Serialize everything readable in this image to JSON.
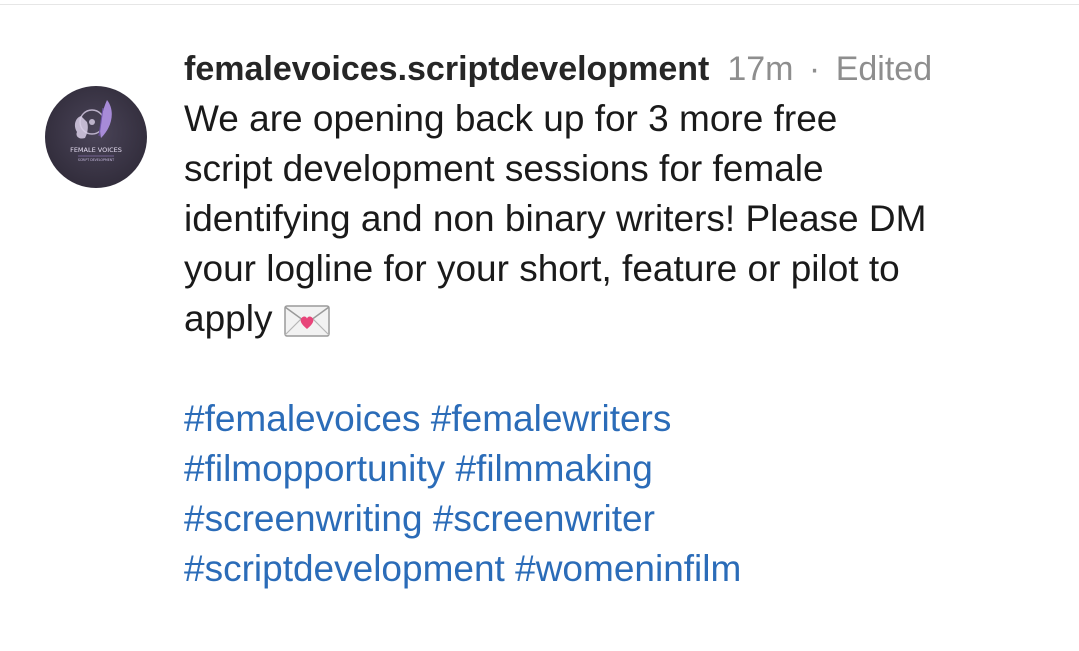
{
  "post": {
    "username": "femalevoices.scriptdevelopment",
    "timestamp": "17m",
    "separator": "·",
    "edited_label": "Edited",
    "avatar_text": "FEMALE VOICES",
    "avatar_subtext": "SCRIPT DEVELOPMENT",
    "caption_lines": [
      "We are opening back up for 3 more free",
      "script development sessions for female",
      "identifying and non binary writers! Please DM",
      "your logline for your short, feature or pilot to",
      "apply"
    ],
    "hashtag_lines": [
      [
        "#femalevoices",
        "#femalewriters"
      ],
      [
        "#filmopportunity",
        "#filmmaking"
      ],
      [
        "#screenwriting",
        "#screenwriter"
      ],
      [
        "#scriptdevelopment",
        "#womeninfilm"
      ]
    ],
    "emoji_icon": "love-letter-icon",
    "colors": {
      "username": "#262626",
      "meta": "#8e8e8e",
      "caption": "#1a1a1a",
      "hashtag": "#2b6cb8",
      "avatar_bg": "#332e3d",
      "avatar_accent": "#a78bd8"
    }
  }
}
